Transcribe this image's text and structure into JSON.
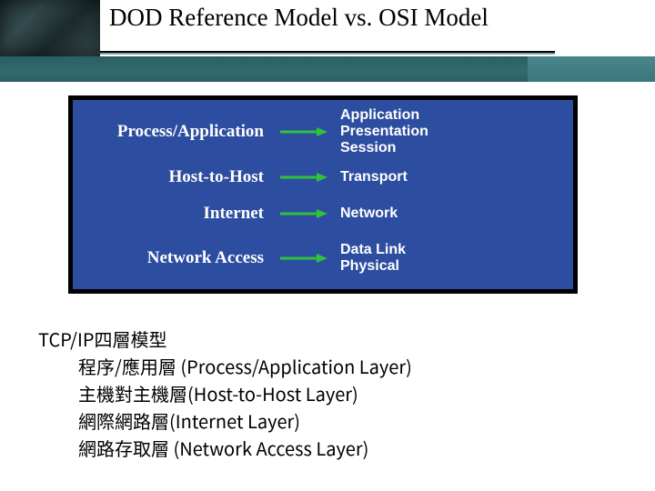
{
  "title": "DOD Reference Model  vs.    OSI Model",
  "diagram": {
    "rows": [
      {
        "left": "Process/Application",
        "right": "Application\nPresentation\nSession"
      },
      {
        "left": "Host-to-Host",
        "right": "Transport"
      },
      {
        "left": "Internet",
        "right": "Network"
      },
      {
        "left": "Network Access",
        "right": "Data Link\nPhysical"
      }
    ],
    "arrow_color": "#2fc23a"
  },
  "summary": {
    "heading": "TCP/IP四層模型",
    "items": [
      "程序/應用層 (Process/Application Layer)",
      "主機對主機層(Host-to-Host Layer)",
      "網際網路層(Internet Layer)",
      "網路存取層 (Network Access Layer)"
    ]
  }
}
